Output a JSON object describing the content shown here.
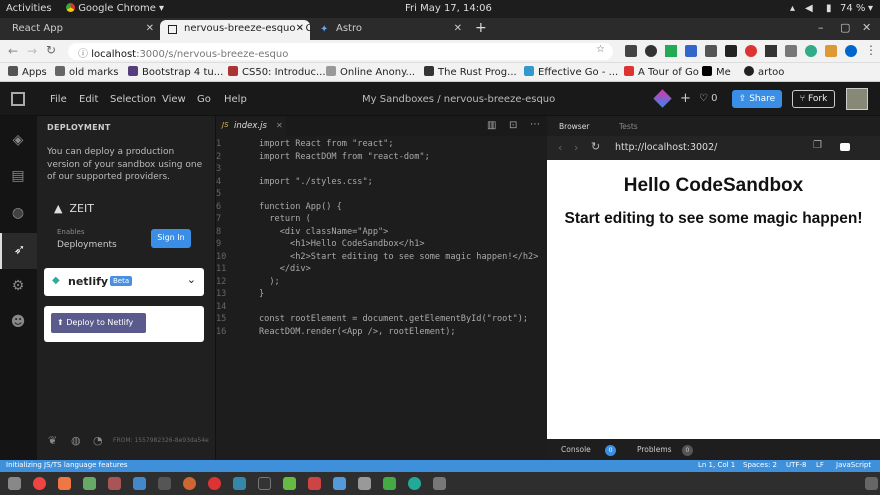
{
  "os": {
    "activities": "Activities",
    "app": "Google Chrome",
    "clock": "Fri May 17, 14:06",
    "battery": "74 %"
  },
  "tabs": [
    {
      "label": "React App"
    },
    {
      "label": "nervous-breeze-esquo - C"
    },
    {
      "label": "Astro"
    }
  ],
  "address": {
    "host": "localhost",
    "path": ":3000/s/nervous-breeze-esquo"
  },
  "bookmarks": [
    "Apps",
    "old marks",
    "Bootstrap 4 tu...",
    "CS50: Introduc...",
    "Online Anony...",
    "The Rust Prog...",
    "Effective Go - ...",
    "A Tour of Go",
    "Me",
    "artoo"
  ],
  "header": {
    "menus": [
      "File",
      "Edit",
      "Selection",
      "View",
      "Go",
      "Help"
    ],
    "breadcrumb": "My Sandboxes / nervous-breeze-esquo",
    "likes": "0",
    "share": "Share",
    "fork": "Fork"
  },
  "deploy": {
    "title": "DEPLOYMENT",
    "desc": "You can deploy a production version of your sandbox using one of our supported providers.",
    "zeit": "ZEIT",
    "enables": "Enables",
    "deployments": "Deployments",
    "signin": "Sign In",
    "netlify": "netlify",
    "netlify_badge": "Beta",
    "deploy_btn": "Deploy to Netlify",
    "footer_code": "FROM: 1557982326-8e93da54e"
  },
  "editor": {
    "filename": "index.js",
    "lines": [
      "import React from \"react\";",
      "import ReactDOM from \"react-dom\";",
      "",
      "import \"./styles.css\";",
      "",
      "function App() {",
      "  return (",
      "    <div className=\"App\">",
      "      <h1>Hello CodeSandbox</h1>",
      "      <h2>Start editing to see some magic happen!</h2>",
      "    </div>",
      "  );",
      "}",
      "",
      "const rootElement = document.getElementById(\"root\");",
      "ReactDOM.render(<App />, rootElement);"
    ]
  },
  "preview": {
    "tab_browser": "Browser",
    "tab_tests": "Tests",
    "url": "http://localhost:3002/",
    "h1": "Hello CodeSandbox",
    "h2": "Start editing to see some magic happen!",
    "console": "Console",
    "console_count": "0",
    "problems": "Problems",
    "problems_count": "0"
  },
  "status": {
    "left": "Initializing JS/TS language features",
    "right": [
      "Ln 1, Col 1",
      "Spaces: 2",
      "UTF-8",
      "LF",
      "JavaScript"
    ]
  },
  "colors": {
    "accent": "#3f90db",
    "share": "#3a8ee6"
  }
}
